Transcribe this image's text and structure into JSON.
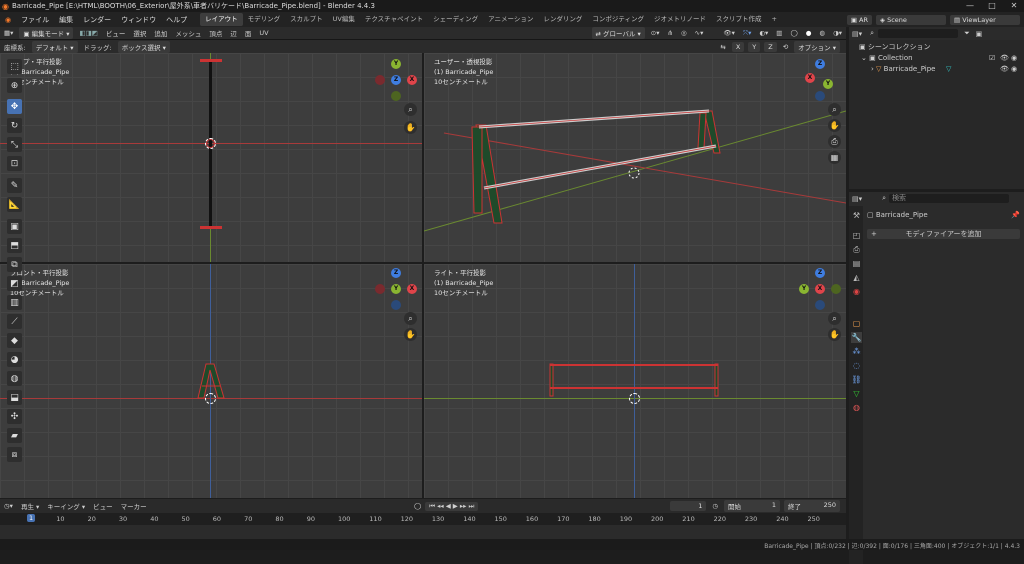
{
  "title": "Barricade_Pipe [E:\\HTML\\BOOTH\\06_Exterior\\屋外系\\車者バリケード\\Barricade_Pipe.blend] - Blender 4.4.3",
  "menu": [
    "ファイル",
    "編集",
    "レンダー",
    "ウィンドウ",
    "ヘルプ"
  ],
  "workspaces": [
    "レイアウト",
    "モデリング",
    "スカルプト",
    "UV編集",
    "テクスチャペイント",
    "シェーディング",
    "アニメーション",
    "レンダリング",
    "コンポジティング",
    "ジオメトリノード",
    "スクリプト作成"
  ],
  "add_tab": "+",
  "render_engine": "AR",
  "scene": "Scene",
  "view_layer": "ViewLayer",
  "header": {
    "editor_mode": "編集モード",
    "menus": [
      "ビュー",
      "選択",
      "追加",
      "メッシュ",
      "頂点",
      "辺",
      "面",
      "UV"
    ],
    "transform_orientation": "グローバル",
    "axes": [
      "X",
      "Y",
      "Z"
    ],
    "options": "オプション"
  },
  "toolsettings": {
    "coord_label": "座標系:",
    "coord_value": "デフォルト",
    "drag_label": "ドラッグ:",
    "drag_value": "ボックス選択"
  },
  "viewports": [
    {
      "name": "トップ・平行投影",
      "object": "(1) Barricade_Pipe",
      "scale": "10センチメートル",
      "gizmo": [
        "Y",
        "X",
        "Z"
      ]
    },
    {
      "name": "ユーザー・透視投影",
      "object": "(1) Barricade_Pipe",
      "scale": "10センチメートル",
      "gizmo": [
        "Z",
        "X",
        "Y"
      ]
    },
    {
      "name": "フロント・平行投影",
      "object": "(1) Barricade_Pipe",
      "scale": "10センチメートル",
      "gizmo": [
        "Z",
        "X",
        "Y"
      ]
    },
    {
      "name": "ライト・平行投影",
      "object": "(1) Barricade_Pipe",
      "scale": "10センチメートル",
      "gizmo": [
        "Z",
        "Y",
        "X"
      ]
    }
  ],
  "outliner": {
    "root": "シーンコレクション",
    "collection": "Collection",
    "object": "Barricade_Pipe"
  },
  "properties": {
    "search_placeholder": "検索",
    "object_name": "Barricade_Pipe",
    "add_modifier": "モディファイアーを追加"
  },
  "timeline": {
    "menus": [
      "再生",
      "キーイング",
      "ビュー",
      "マーカー"
    ],
    "current_frame": "1",
    "start_label": "開始",
    "start": "1",
    "end_label": "終了",
    "end": "250",
    "ticks": [
      "10",
      "20",
      "30",
      "40",
      "50",
      "60",
      "70",
      "80",
      "90",
      "100",
      "110",
      "120",
      "130",
      "140",
      "150",
      "160",
      "170",
      "180",
      "190",
      "200",
      "210",
      "220",
      "230",
      "240",
      "250"
    ],
    "playhead": "1"
  },
  "status": "Barricade_Pipe | 頂点:0/232 | 辺:0/392 | 面:0/176 | 三角面:400 | オブジェクト:1/1 | 4.4.3",
  "colors": {
    "accent": "#4772b3",
    "x_axis": "#e0444a",
    "y_axis": "#8ab531",
    "z_axis": "#3f7de0",
    "active_ws": "#3d3d3d"
  }
}
